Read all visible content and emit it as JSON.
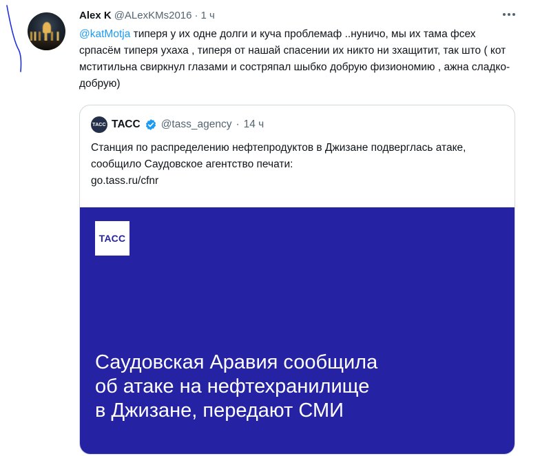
{
  "tweet": {
    "author_name": "Alex K",
    "author_handle": "@ALexKMs2016",
    "separator": "·",
    "time": "1 ч",
    "mention": "@katMotja",
    "text": " типеря у их одне долги и куча проблемаф ..нуничо, мы их тама фсех српасём типеря ухаха , типеря от нашай спасении их никто ни зхащитит, так што ( кот мститильна свиркнул глазами и состряпал шыбко добрую физиономию , ажна сладко-добрую)"
  },
  "quote": {
    "avatar_text": "ТАСС",
    "name": "ТАСС",
    "handle": "@tass_agency",
    "separator": "·",
    "time": "14 ч",
    "text": "Станция по распределению нефтепродуктов в Джизане подверглась атаке, сообщило Саудовское агентство печати:",
    "link": "go.tass.ru/cfnr",
    "media": {
      "logo_text": "ТАСС",
      "headline_lines": [
        "Саудовская Аравия сообщила",
        "об атаке на нефтехранилище",
        "в Джизане, передают СМИ"
      ],
      "background_color": "#2523a3"
    }
  },
  "colors": {
    "link": "#1d9bf0",
    "secondary_text": "#536471",
    "border": "#cfd9de",
    "verified": "#1d9bf0",
    "pen_mark": "#1c2fe0"
  },
  "icons": {
    "more": "more-dots-icon",
    "verified": "verified-badge-icon"
  }
}
